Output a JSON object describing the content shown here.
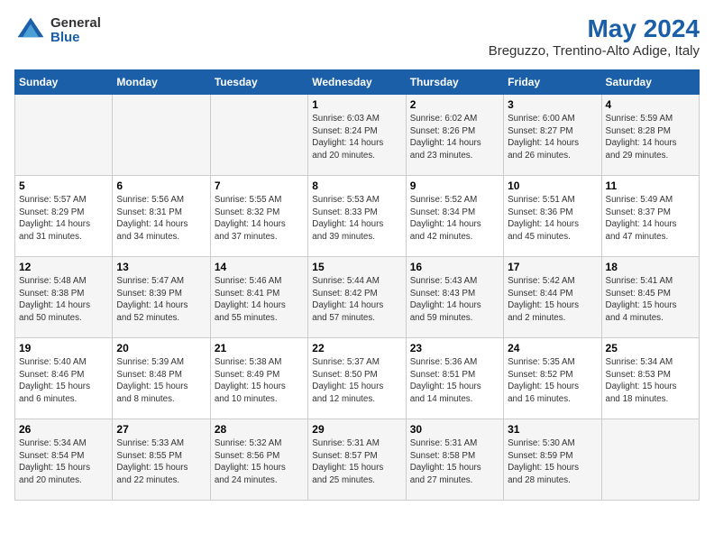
{
  "header": {
    "logo_general": "General",
    "logo_blue": "Blue",
    "title": "May 2024",
    "subtitle": "Breguzzo, Trentino-Alto Adige, Italy"
  },
  "weekdays": [
    "Sunday",
    "Monday",
    "Tuesday",
    "Wednesday",
    "Thursday",
    "Friday",
    "Saturday"
  ],
  "weeks": [
    [
      {
        "day": "",
        "info": ""
      },
      {
        "day": "",
        "info": ""
      },
      {
        "day": "",
        "info": ""
      },
      {
        "day": "1",
        "info": "Sunrise: 6:03 AM\nSunset: 8:24 PM\nDaylight: 14 hours\nand 20 minutes."
      },
      {
        "day": "2",
        "info": "Sunrise: 6:02 AM\nSunset: 8:26 PM\nDaylight: 14 hours\nand 23 minutes."
      },
      {
        "day": "3",
        "info": "Sunrise: 6:00 AM\nSunset: 8:27 PM\nDaylight: 14 hours\nand 26 minutes."
      },
      {
        "day": "4",
        "info": "Sunrise: 5:59 AM\nSunset: 8:28 PM\nDaylight: 14 hours\nand 29 minutes."
      }
    ],
    [
      {
        "day": "5",
        "info": "Sunrise: 5:57 AM\nSunset: 8:29 PM\nDaylight: 14 hours\nand 31 minutes."
      },
      {
        "day": "6",
        "info": "Sunrise: 5:56 AM\nSunset: 8:31 PM\nDaylight: 14 hours\nand 34 minutes."
      },
      {
        "day": "7",
        "info": "Sunrise: 5:55 AM\nSunset: 8:32 PM\nDaylight: 14 hours\nand 37 minutes."
      },
      {
        "day": "8",
        "info": "Sunrise: 5:53 AM\nSunset: 8:33 PM\nDaylight: 14 hours\nand 39 minutes."
      },
      {
        "day": "9",
        "info": "Sunrise: 5:52 AM\nSunset: 8:34 PM\nDaylight: 14 hours\nand 42 minutes."
      },
      {
        "day": "10",
        "info": "Sunrise: 5:51 AM\nSunset: 8:36 PM\nDaylight: 14 hours\nand 45 minutes."
      },
      {
        "day": "11",
        "info": "Sunrise: 5:49 AM\nSunset: 8:37 PM\nDaylight: 14 hours\nand 47 minutes."
      }
    ],
    [
      {
        "day": "12",
        "info": "Sunrise: 5:48 AM\nSunset: 8:38 PM\nDaylight: 14 hours\nand 50 minutes."
      },
      {
        "day": "13",
        "info": "Sunrise: 5:47 AM\nSunset: 8:39 PM\nDaylight: 14 hours\nand 52 minutes."
      },
      {
        "day": "14",
        "info": "Sunrise: 5:46 AM\nSunset: 8:41 PM\nDaylight: 14 hours\nand 55 minutes."
      },
      {
        "day": "15",
        "info": "Sunrise: 5:44 AM\nSunset: 8:42 PM\nDaylight: 14 hours\nand 57 minutes."
      },
      {
        "day": "16",
        "info": "Sunrise: 5:43 AM\nSunset: 8:43 PM\nDaylight: 14 hours\nand 59 minutes."
      },
      {
        "day": "17",
        "info": "Sunrise: 5:42 AM\nSunset: 8:44 PM\nDaylight: 15 hours\nand 2 minutes."
      },
      {
        "day": "18",
        "info": "Sunrise: 5:41 AM\nSunset: 8:45 PM\nDaylight: 15 hours\nand 4 minutes."
      }
    ],
    [
      {
        "day": "19",
        "info": "Sunrise: 5:40 AM\nSunset: 8:46 PM\nDaylight: 15 hours\nand 6 minutes."
      },
      {
        "day": "20",
        "info": "Sunrise: 5:39 AM\nSunset: 8:48 PM\nDaylight: 15 hours\nand 8 minutes."
      },
      {
        "day": "21",
        "info": "Sunrise: 5:38 AM\nSunset: 8:49 PM\nDaylight: 15 hours\nand 10 minutes."
      },
      {
        "day": "22",
        "info": "Sunrise: 5:37 AM\nSunset: 8:50 PM\nDaylight: 15 hours\nand 12 minutes."
      },
      {
        "day": "23",
        "info": "Sunrise: 5:36 AM\nSunset: 8:51 PM\nDaylight: 15 hours\nand 14 minutes."
      },
      {
        "day": "24",
        "info": "Sunrise: 5:35 AM\nSunset: 8:52 PM\nDaylight: 15 hours\nand 16 minutes."
      },
      {
        "day": "25",
        "info": "Sunrise: 5:34 AM\nSunset: 8:53 PM\nDaylight: 15 hours\nand 18 minutes."
      }
    ],
    [
      {
        "day": "26",
        "info": "Sunrise: 5:34 AM\nSunset: 8:54 PM\nDaylight: 15 hours\nand 20 minutes."
      },
      {
        "day": "27",
        "info": "Sunrise: 5:33 AM\nSunset: 8:55 PM\nDaylight: 15 hours\nand 22 minutes."
      },
      {
        "day": "28",
        "info": "Sunrise: 5:32 AM\nSunset: 8:56 PM\nDaylight: 15 hours\nand 24 minutes."
      },
      {
        "day": "29",
        "info": "Sunrise: 5:31 AM\nSunset: 8:57 PM\nDaylight: 15 hours\nand 25 minutes."
      },
      {
        "day": "30",
        "info": "Sunrise: 5:31 AM\nSunset: 8:58 PM\nDaylight: 15 hours\nand 27 minutes."
      },
      {
        "day": "31",
        "info": "Sunrise: 5:30 AM\nSunset: 8:59 PM\nDaylight: 15 hours\nand 28 minutes."
      },
      {
        "day": "",
        "info": ""
      }
    ]
  ]
}
